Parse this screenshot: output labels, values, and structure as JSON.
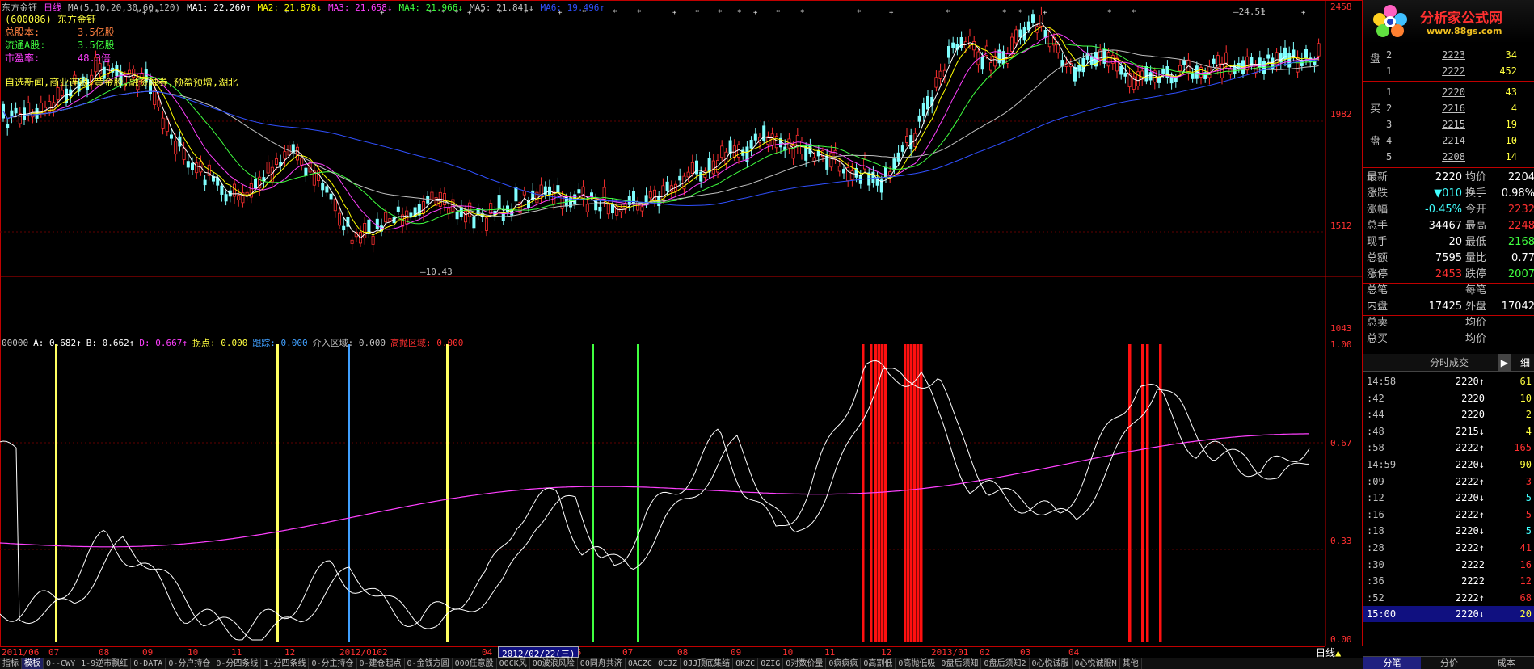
{
  "header": {
    "stock_name": "东方金钰",
    "period": "日线",
    "ma_params": "MA(5,10,20,30,60,120)",
    "ma1": "MA1: 22.260↑",
    "ma2": "MA2: 21.878↓",
    "ma3": "MA3: 21.658↓",
    "ma4": "MA4: 21.966↓",
    "ma5": "MA5: 21.841↓",
    "ma6": "MA6: 19.496↑"
  },
  "info": {
    "code": "(600086) 东方金钰",
    "total_shares_label": "总股本:",
    "total_shares_value": "3.5亿股",
    "float_shares_label": "流通A股:",
    "float_shares_value": "3.5亿股",
    "pe_label": "市盈率:",
    "pe_value": "48.3倍",
    "concepts": "自选新闻,商业连锁,黄金股,融资融券,预盈预增,湖北"
  },
  "price_axis": [
    "2458",
    "1982",
    "1512",
    "1043"
  ],
  "price_annotations": {
    "high": "24.51",
    "low": "10.43"
  },
  "indicator": {
    "code": "00000",
    "a": "A: 0.682↑",
    "b": "B: 0.662↑",
    "d": "D: 0.667↑",
    "guaidian": "拐点: 0.000",
    "genzong": "跟踪: 0.000",
    "jieru": "介入区域: 0.000",
    "gaopao": "高抛区域: 0.000",
    "axis": [
      "1.00",
      "0.67",
      "0.33",
      "0.00"
    ]
  },
  "dates": [
    "2011/06",
    "07",
    "08",
    "09",
    "10",
    "11",
    "12",
    "2012/0102",
    "04",
    "05",
    "06",
    "07",
    "08",
    "09",
    "10",
    "11",
    "12",
    "2013/01",
    "02",
    "03",
    "04"
  ],
  "date_badge": "2012/02/22(三)",
  "period_label": "日线",
  "tabs": [
    "指标",
    "模板",
    "0--CWY",
    "1-9逆市飘红",
    "0-DATA",
    "0-分户持仓",
    "0-分四条线",
    "1-分四条线",
    "0-分主持仓",
    "0-建仓起点",
    "0-金钱方圆",
    "000任意股",
    "00CK风",
    "00波浪风险",
    "00同舟共济",
    "0ACZC",
    "0CJZ",
    "0JJ顶底集结",
    "0KZC",
    "0ZIG",
    "0对数价量",
    "0疯疯疯",
    "0高割低",
    "0高抛低吸",
    "0盘后须知",
    "0盘后须知2",
    "0心悦诚服",
    "0心悦诚服M",
    "其他"
  ],
  "logo": {
    "title": "分析家公式网",
    "url": "www.88gs.com"
  },
  "orderbook": {
    "sell_label": "盘",
    "buy_label_1": "买",
    "buy_label_2": "盘",
    "sell": [
      {
        "lvl": "2",
        "price": "2223",
        "vol": "34"
      },
      {
        "lvl": "1",
        "price": "2222",
        "vol": "452"
      }
    ],
    "buy": [
      {
        "lvl": "1",
        "price": "2220",
        "vol": "43"
      },
      {
        "lvl": "2",
        "price": "2216",
        "vol": "4"
      },
      {
        "lvl": "3",
        "price": "2215",
        "vol": "19"
      },
      {
        "lvl": "4",
        "price": "2214",
        "vol": "10"
      },
      {
        "lvl": "5",
        "price": "2208",
        "vol": "14"
      }
    ]
  },
  "stats": [
    {
      "k1": "最新",
      "v1": "2220",
      "c1": "#ffffff",
      "k2": "均价",
      "v2": "2204",
      "c2": "#ffffff"
    },
    {
      "k1": "涨跌",
      "v1": "▼010",
      "c1": "#40ffff",
      "k2": "换手",
      "v2": "0.98%",
      "c2": "#ffffff"
    },
    {
      "k1": "涨幅",
      "v1": "-0.45%",
      "c1": "#40ffff",
      "k2": "今开",
      "v2": "2232",
      "c2": "#ff3030"
    },
    {
      "k1": "总手",
      "v1": "34467",
      "c1": "#ffffff",
      "k2": "最高",
      "v2": "2248",
      "c2": "#ff3030"
    },
    {
      "k1": "现手",
      "v1": "20",
      "c1": "#ffffff",
      "k2": "最低",
      "v2": "2168",
      "c2": "#40ff40"
    },
    {
      "k1": "总额",
      "v1": "7595",
      "c1": "#ffffff",
      "k2": "量比",
      "v2": "0.77",
      "c2": "#ffffff"
    },
    {
      "k1": "涨停",
      "v1": "2453",
      "c1": "#ff3030",
      "k2": "跌停",
      "v2": "2007",
      "c2": "#40ff40"
    },
    {
      "k1": "总笔",
      "v1": "",
      "c1": "#ffffff",
      "k2": "每笔",
      "v2": "",
      "c2": "#ffffff"
    },
    {
      "k1": "内盘",
      "v1": "17425",
      "c1": "#ffffff",
      "k2": "外盘",
      "v2": "17042",
      "c2": "#ffffff"
    },
    {
      "k1": "总卖",
      "v1": "",
      "c1": "#ffffff",
      "k2": "均价",
      "v2": "",
      "c2": "#ffffff"
    },
    {
      "k1": "总买",
      "v1": "",
      "c1": "#ffffff",
      "k2": "均价",
      "v2": "",
      "c2": "#ffffff"
    }
  ],
  "ticks_header": "分时成交",
  "ticks_header_right": "细",
  "ticks": [
    {
      "t": "14:58",
      "p": "2220↑",
      "v": "61",
      "pc": "#ffffff",
      "vc": "#ffff40"
    },
    {
      "t": ":42",
      "p": "2220",
      "v": "10",
      "pc": "#ffffff",
      "vc": "#ffff40"
    },
    {
      "t": ":44",
      "p": "2220",
      "v": "2",
      "pc": "#ffffff",
      "vc": "#ffff40"
    },
    {
      "t": ":48",
      "p": "2215↓",
      "v": "4",
      "pc": "#ffffff",
      "vc": "#ffff40"
    },
    {
      "t": ":58",
      "p": "2222↑",
      "v": "165",
      "pc": "#ffffff",
      "vc": "#ff3030"
    },
    {
      "t": "14:59",
      "p": "2220↓",
      "v": "90",
      "pc": "#ffffff",
      "vc": "#ffff40"
    },
    {
      "t": ":09",
      "p": "2222↑",
      "v": "3",
      "pc": "#ffffff",
      "vc": "#ff3030"
    },
    {
      "t": ":12",
      "p": "2220↓",
      "v": "5",
      "pc": "#ffffff",
      "vc": "#40ffff"
    },
    {
      "t": ":16",
      "p": "2222↑",
      "v": "5",
      "pc": "#ffffff",
      "vc": "#ff3030"
    },
    {
      "t": ":18",
      "p": "2220↓",
      "v": "5",
      "pc": "#ffffff",
      "vc": "#40ffff"
    },
    {
      "t": ":28",
      "p": "2222↑",
      "v": "41",
      "pc": "#ffffff",
      "vc": "#ff3030"
    },
    {
      "t": ":30",
      "p": "2222",
      "v": "16",
      "pc": "#ffffff",
      "vc": "#ff3030"
    },
    {
      "t": ":36",
      "p": "2222",
      "v": "12",
      "pc": "#ffffff",
      "vc": "#ff3030"
    },
    {
      "t": ":52",
      "p": "2222↑",
      "v": "68",
      "pc": "#ffffff",
      "vc": "#ff3030"
    },
    {
      "t": "15:00",
      "p": "2220↓",
      "v": "20",
      "pc": "#ffffff",
      "vc": "#ffff40",
      "hl": true
    }
  ],
  "right_tabs": [
    "分笔",
    "分价",
    "成本"
  ],
  "colors": {
    "ma1": "#ffffff",
    "ma2": "#ffff00",
    "ma3": "#ff40ff",
    "ma4": "#40ff40",
    "ma5": "#c0c0c0",
    "ma6": "#3050ff",
    "bull_candle": "#ff3030",
    "bear_candle": "#80ffff",
    "signal_yellow": "#ffff60",
    "signal_blue": "#40a0ff",
    "signal_green": "#40ff40",
    "signal_red": "#ff1010"
  }
}
